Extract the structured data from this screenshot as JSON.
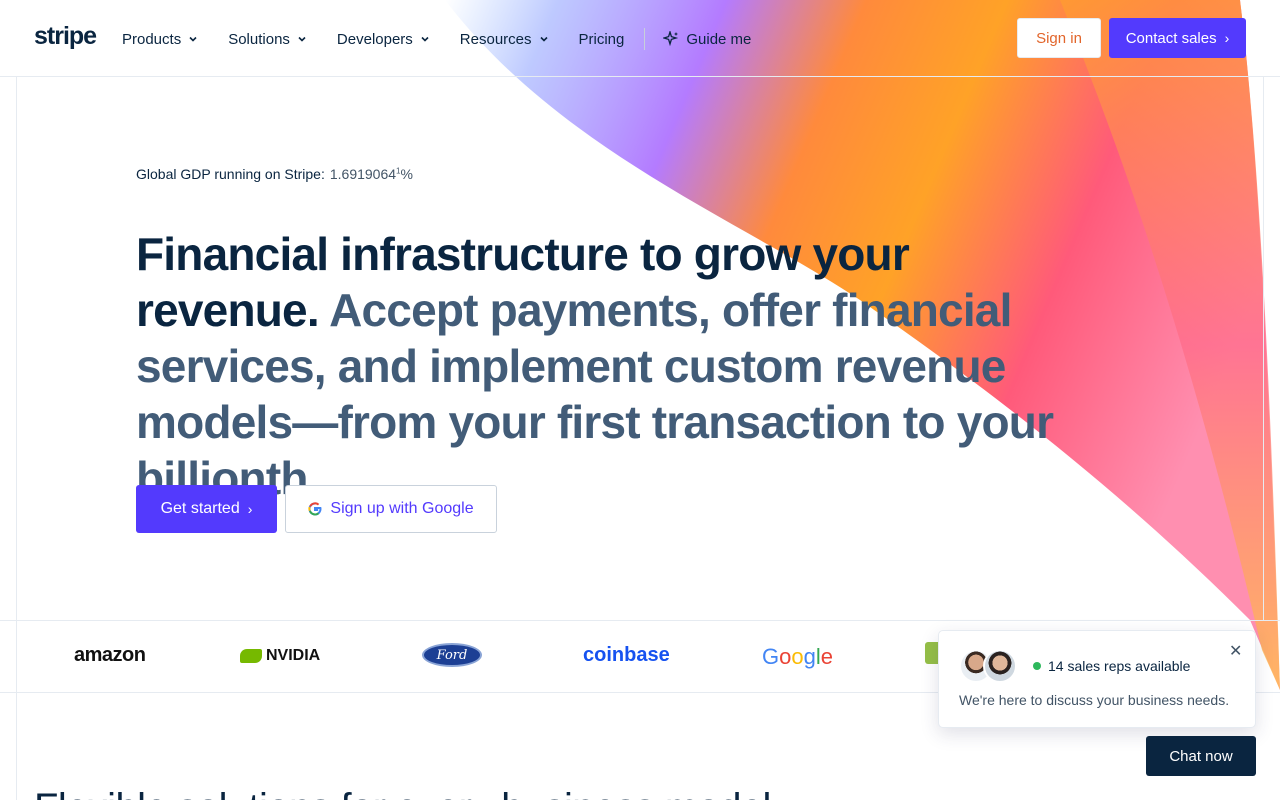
{
  "brand": {
    "logo": "stripe",
    "colors": {
      "accent": "#533afd",
      "navy": "#0a2540",
      "slate": "#425c78",
      "signin": "#e2652b",
      "online": "#2eb85c"
    }
  },
  "nav": {
    "items": [
      {
        "label": "Products",
        "has_dropdown": true
      },
      {
        "label": "Solutions",
        "has_dropdown": true
      },
      {
        "label": "Developers",
        "has_dropdown": true
      },
      {
        "label": "Resources",
        "has_dropdown": true
      },
      {
        "label": "Pricing",
        "has_dropdown": false
      }
    ],
    "guide_label": "Guide me",
    "guide_icon": "sparkle-icon",
    "signin_label": "Sign in",
    "contact_label": "Contact sales"
  },
  "hero": {
    "gdp_label": "Global GDP running on Stripe:",
    "gdp_value": "1.6919064",
    "gdp_rolling_digit": "1",
    "gdp_unit": "%",
    "title_line": "Financial infrastructure to grow your revenue.",
    "subtitle": "Accept payments, offer financial services, and implement custom revenue models—from your first transaction to your billionth.",
    "cta_primary": "Get started",
    "cta_google": "Sign up with Google"
  },
  "customers": {
    "logos": [
      "amazon",
      "NVIDIA",
      "Ford",
      "coinbase",
      "Google",
      "shopify"
    ]
  },
  "chat": {
    "reps_status": "14 sales reps available",
    "message": "We're here to discuss your business needs.",
    "close_icon": "close-icon",
    "button": "Chat now"
  },
  "next_section": {
    "heading_partial": "Flexible solutions for every business model."
  }
}
